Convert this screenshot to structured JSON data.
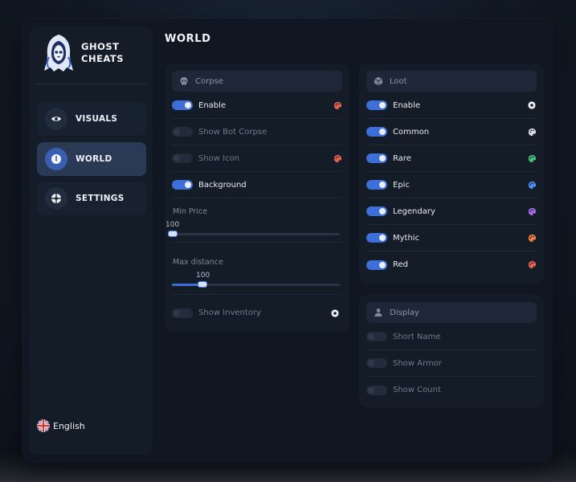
{
  "brand": {
    "line1": "GHOST",
    "line2": "CHEATS"
  },
  "nav": [
    {
      "label": "VISUALS",
      "icon": "eye-icon",
      "active": false
    },
    {
      "label": "WORLD",
      "icon": "compass-icon",
      "active": true
    },
    {
      "label": "SETTINGS",
      "icon": "crosshair-icon",
      "active": false
    }
  ],
  "language": {
    "label": "English",
    "icon": "uk-flag-icon"
  },
  "page_title": "WORLD",
  "corpse": {
    "header": "Corpse",
    "rows": [
      {
        "label": "Enable",
        "on": true,
        "trailing": "palette-icon",
        "trailing_color": "#e8624e"
      },
      {
        "label": "Show Bot Corpse",
        "on": false
      },
      {
        "label": "Show Icon",
        "on": false,
        "trailing": "palette-icon",
        "trailing_color": "#e8624e"
      },
      {
        "label": "Background",
        "on": true
      }
    ],
    "min_price": {
      "label": "Min Price",
      "value": "100",
      "fraction": 0.0
    },
    "max_distance": {
      "label": "Max distance",
      "value": "100",
      "fraction": 0.2
    },
    "show_inventory": {
      "label": "Show Inventory",
      "on": false,
      "trailing": "gear-icon"
    }
  },
  "loot": {
    "header": "Loot",
    "rows": [
      {
        "label": "Enable",
        "on": true,
        "trailing": "gear-icon"
      },
      {
        "label": "Common",
        "on": true,
        "trailing": "palette-icon",
        "trailing_color": "#d7dce3"
      },
      {
        "label": "Rare",
        "on": true,
        "trailing": "palette-icon",
        "trailing_color": "#45c07a"
      },
      {
        "label": "Epic",
        "on": true,
        "trailing": "palette-icon",
        "trailing_color": "#4c8ef2"
      },
      {
        "label": "Legendary",
        "on": true,
        "trailing": "palette-icon",
        "trailing_color": "#a46cf0"
      },
      {
        "label": "Mythic",
        "on": true,
        "trailing": "palette-icon",
        "trailing_color": "#ef7b3e"
      },
      {
        "label": "Red",
        "on": true,
        "trailing": "palette-icon",
        "trailing_color": "#e8624e"
      }
    ]
  },
  "display": {
    "header": "Display",
    "rows": [
      {
        "label": "Short Name",
        "on": false
      },
      {
        "label": "Show Armor",
        "on": false
      },
      {
        "label": "Show Count",
        "on": false
      }
    ]
  },
  "colors": {
    "accent": "#3e6fd8",
    "background": "#101722",
    "panel": "#141c28"
  }
}
